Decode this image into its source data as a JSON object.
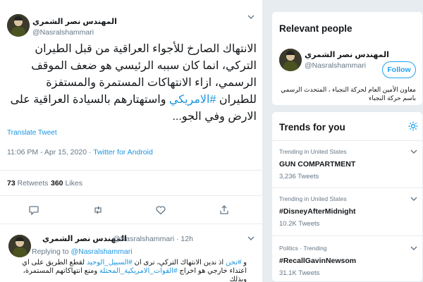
{
  "main_tweet": {
    "author_name": "المهندس نصر الشمري",
    "author_handle": "@Nasralshammari",
    "text_before_hashtag": "الانتهاك الصارخ للأجواء العراقية من قبل الطيران التركي، انما كان سببه الرئيسي هو ضعف الموقف الرسمي، ازاء الانتهاكات المستمرة والمستفزة للطيران ",
    "hashtag": "#الامريكي",
    "text_after_hashtag": " واستهتارهم بالسيادة العراقية على الارض وفي الجو...",
    "translate_label": "Translate Tweet",
    "timestamp": "11:06 PM - Apr 15, 2020",
    "separator": " · ",
    "source": "Twitter for Android",
    "retweets_count": "73",
    "retweets_label": "Retweets",
    "likes_count": "360",
    "likes_label": "Likes"
  },
  "reply_tweet": {
    "author_name": "المهندس نصر الشمري",
    "author_handle": "@Nasralshammari",
    "time_ago": "· 12h",
    "replying_label": "Replying to",
    "replying_handle": "@Nasralshammari",
    "text_prefix": "و ",
    "hashtag1": "#نحن",
    "text_mid1": " اذ ندين الانتهاك التركي، نرى ان ",
    "hashtag2": "#السبيل_الوحيد",
    "text_mid2": " لقطع الطريق على اي اعتداء خارجي هو اخراج ",
    "hashtag3": "#القوات_الامريكية_المحتلة",
    "text_end": " ومنع انتهاكاتهم المستمرة، وبذلك"
  },
  "relevant_people": {
    "title": "Relevant people",
    "name": "المهندس نصر الشمري",
    "handle": "@Nasralshammari",
    "follow_label": "Follow",
    "bio": "معاون الأمين العام لحركة النجباء ، المتحدث الرسمي باسم حركة النجباء"
  },
  "trends": {
    "title": "Trends for you",
    "items": [
      {
        "context": "Trending in United States",
        "name": "GUN COMPARTMENT",
        "count": "3,236 Tweets"
      },
      {
        "context": "Trending in United States",
        "name": "#DisneyAfterMidnight",
        "count": "10.2K Tweets"
      },
      {
        "context": "Politics · Trending",
        "name": "#RecallGavinNewsom",
        "count": "31.1K Tweets"
      }
    ]
  },
  "icons": {
    "reply": "reply-icon",
    "retweet": "retweet-icon",
    "like": "heart-icon",
    "share": "share-icon",
    "settings": "gear-icon",
    "caret": "chevron-down-icon"
  },
  "colors": {
    "accent": "#1da1f2",
    "link": "#1b95e0",
    "secondary_text": "#657786",
    "background": "#e6ecf0"
  }
}
